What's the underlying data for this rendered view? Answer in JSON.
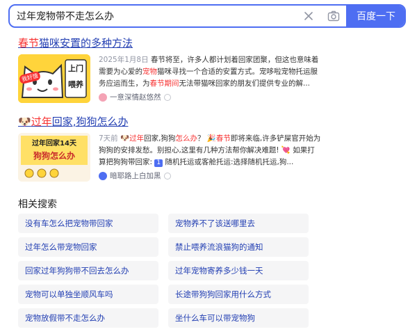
{
  "search": {
    "query": "过年宠物带不走怎么办",
    "button_label": "百度一下"
  },
  "results": [
    {
      "title_hl": "春节",
      "title_rest": "猫咪安置的多种方法",
      "thumb_line1": "上门",
      "thumb_line2": "喂养",
      "thumb_badge": "我好饿",
      "date": "2025年1月8日",
      "snippet_a": "春节将至，许多人都计划着回家团聚，但这也意味着需要为心爱的",
      "snippet_hl1": "宠物",
      "snippet_b": "猫咪寻找一个合适的安置方式。宠哆啦宠物托运服务应运而生，为",
      "snippet_hl2": "春节期间",
      "snippet_c": "无法带猫咪回家的朋友们提供专业的解...",
      "source": "一意深情赵悠然"
    },
    {
      "emoji": "🐶",
      "title_hl": "过年",
      "title_rest": "回家,狗狗怎么办",
      "thumb_line1": "过年回家14天",
      "thumb_line2": "狗狗怎么办",
      "date": "7天前",
      "snippet_a": "🐶",
      "snippet_hl1": "过年",
      "snippet_b": "回家,狗狗",
      "snippet_hl2": "怎么办",
      "snippet_c": "？ 🎉",
      "snippet_hl3": "春节",
      "snippet_d": "即将来临,许多铲屎官开始为狗狗的安排发愁。别担心,这里有几种方法帮你解决难题! 💘 如果打算把狗狗带回家: ",
      "snippet_num": "1",
      "snippet_e": " 随机托运或客舱托运:选择随机托运,狗...",
      "source": "暗耶路上白加黑"
    }
  ],
  "related": {
    "title": "相关搜索",
    "items": [
      "没有车怎么把宠物带回家",
      "宠物养不了该送哪里去",
      "过年怎么带宠物回家",
      "禁止喂养流浪猫狗的通知",
      "回家过年狗狗带不回去怎么办",
      "过年宠物寄养多少钱一天",
      "宠物可以单独坐顺风车吗",
      "长途带狗狗回家用什么方式",
      "宠物放假带不走怎么办",
      "坐什么车可以带宠物狗"
    ]
  },
  "colors": {
    "accent": "#4e6ef2",
    "link": "#2440b3",
    "highlight": "#f73131"
  }
}
